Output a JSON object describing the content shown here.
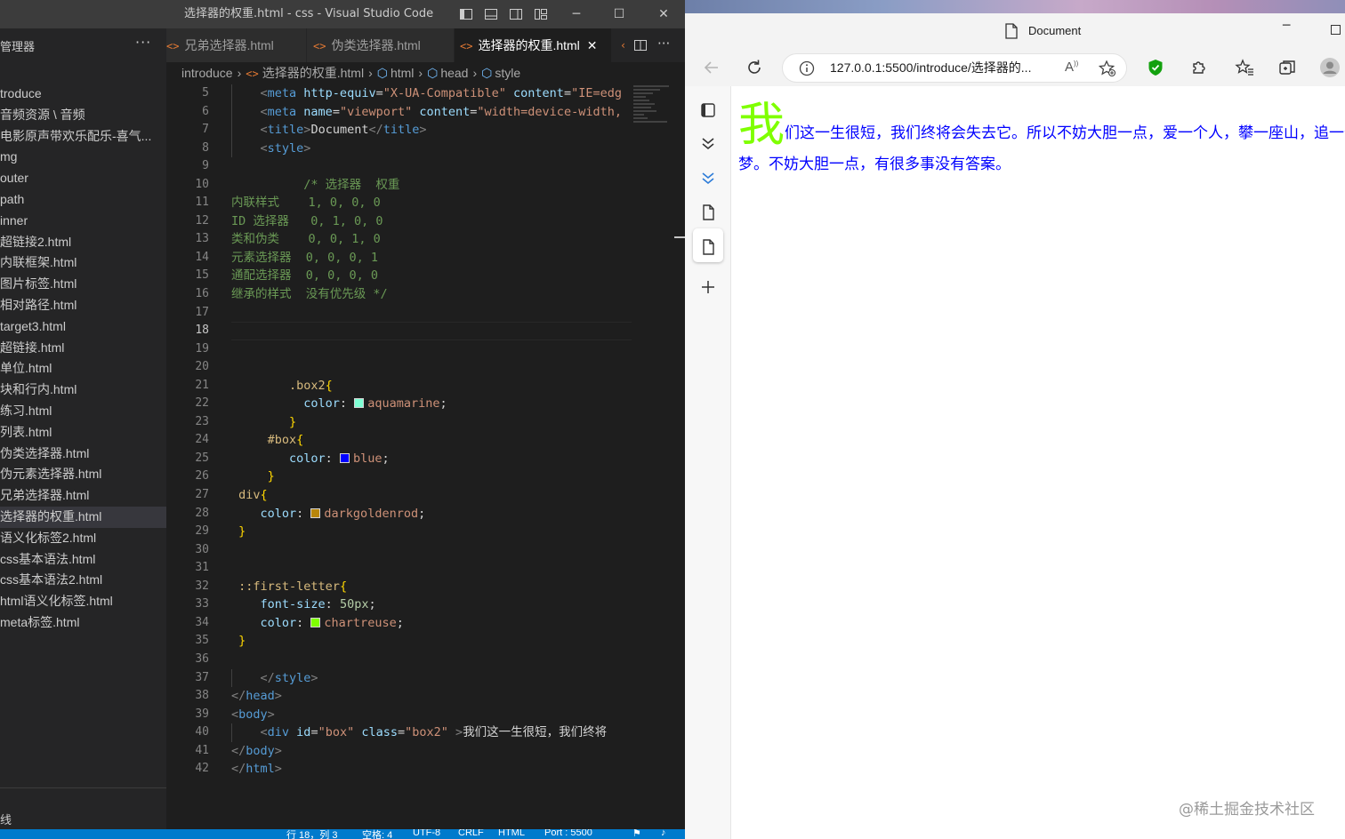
{
  "vscode": {
    "window_title": "选择器的权重.html - css - Visual Studio Code",
    "explorer": {
      "header": "管理器",
      "more": "···",
      "items": [
        {
          "label": "troduce",
          "active": false
        },
        {
          "label": "音频资源 \\ 音频",
          "active": false
        },
        {
          "label": "电影原声带欢乐配乐-喜气...",
          "active": false
        },
        {
          "label": "mg",
          "active": false
        },
        {
          "label": "outer",
          "active": false
        },
        {
          "label": "path",
          "active": false
        },
        {
          "label": "inner",
          "active": false
        },
        {
          "label": "超链接2.html",
          "active": false
        },
        {
          "label": "内联框架.html",
          "active": false
        },
        {
          "label": "图片标签.html",
          "active": false
        },
        {
          "label": "相对路径.html",
          "active": false
        },
        {
          "label": "target3.html",
          "active": false
        },
        {
          "label": "超链接.html",
          "active": false
        },
        {
          "label": "单位.html",
          "active": false
        },
        {
          "label": "块和行内.html",
          "active": false
        },
        {
          "label": "练习.html",
          "active": false
        },
        {
          "label": "列表.html",
          "active": false
        },
        {
          "label": "伪类选择器.html",
          "active": false
        },
        {
          "label": "伪元素选择器.html",
          "active": false
        },
        {
          "label": "兄弟选择器.html",
          "active": false
        },
        {
          "label": "选择器的权重.html",
          "active": true
        },
        {
          "label": "语义化标签2.html",
          "active": false
        },
        {
          "label": "css基本语法.html",
          "active": false
        },
        {
          "label": "css基本语法2.html",
          "active": false
        },
        {
          "label": "html语义化标签.html",
          "active": false
        },
        {
          "label": "meta标签.html",
          "active": false
        }
      ],
      "outline": "线"
    },
    "tabs": [
      {
        "label": "兄弟选择器.html",
        "active": false
      },
      {
        "label": "伪类选择器.html",
        "active": false
      },
      {
        "label": "选择器的权重.html",
        "active": true
      }
    ],
    "tab_icon": "<>",
    "tab_close": "✕",
    "breadcrumb": [
      "introduce",
      "选择器的权重.html",
      "html",
      "head",
      "style"
    ],
    "status": {
      "position": "行 18，列 3",
      "spaces": "空格: 4",
      "encoding": "UTF-8",
      "eol": "CRLF",
      "language": "HTML",
      "port": "Port : 5500"
    },
    "code": {
      "current_line": 18,
      "lines": [
        {
          "n": 5,
          "indent": 1,
          "tokens": [
            [
              "t-punc",
              "<"
            ],
            [
              "t-tag",
              "meta "
            ],
            [
              "t-attr",
              "http-equiv"
            ],
            [
              "t-text",
              "="
            ],
            [
              "t-str",
              "\"X-UA-Compatible\" "
            ],
            [
              "t-attr",
              "content"
            ],
            [
              "t-text",
              "="
            ],
            [
              "t-str",
              "\"IE=edg"
            ]
          ]
        },
        {
          "n": 6,
          "indent": 1,
          "tokens": [
            [
              "t-punc",
              "<"
            ],
            [
              "t-tag",
              "meta "
            ],
            [
              "t-attr",
              "name"
            ],
            [
              "t-text",
              "="
            ],
            [
              "t-str",
              "\"viewport\" "
            ],
            [
              "t-attr",
              "content"
            ],
            [
              "t-text",
              "="
            ],
            [
              "t-str",
              "\"width=device-width,"
            ]
          ]
        },
        {
          "n": 7,
          "indent": 1,
          "tokens": [
            [
              "t-punc",
              "<"
            ],
            [
              "t-tag",
              "title"
            ],
            [
              "t-punc",
              ">"
            ],
            [
              "t-text",
              "Document"
            ],
            [
              "t-punc",
              "</"
            ],
            [
              "t-tag",
              "title"
            ],
            [
              "t-punc",
              ">"
            ]
          ]
        },
        {
          "n": 8,
          "indent": 1,
          "tokens": [
            [
              "t-punc",
              "<"
            ],
            [
              "t-tag",
              "style"
            ],
            [
              "t-punc",
              ">"
            ]
          ]
        },
        {
          "n": 9,
          "indent": 0,
          "tokens": []
        },
        {
          "n": 10,
          "indent": 0,
          "tokens": [
            [
              "t-com",
              "          /* 选择器  权重"
            ]
          ]
        },
        {
          "n": 11,
          "indent": 0,
          "tokens": [
            [
              "t-com",
              "内联样式    1, 0, 0, 0"
            ]
          ]
        },
        {
          "n": 12,
          "indent": 0,
          "tokens": [
            [
              "t-com",
              "ID 选择器   0, 1, 0, 0"
            ]
          ]
        },
        {
          "n": 13,
          "indent": 0,
          "tokens": [
            [
              "t-com",
              "类和伪类    0, 0, 1, 0"
            ]
          ]
        },
        {
          "n": 14,
          "indent": 0,
          "tokens": [
            [
              "t-com",
              "元素选择器  0, 0, 0, 1"
            ]
          ]
        },
        {
          "n": 15,
          "indent": 0,
          "tokens": [
            [
              "t-com",
              "通配选择器  0, 0, 0, 0"
            ]
          ]
        },
        {
          "n": 16,
          "indent": 0,
          "tokens": [
            [
              "t-com",
              "继承的样式  没有优先级 */"
            ]
          ]
        },
        {
          "n": 17,
          "indent": 0,
          "tokens": []
        },
        {
          "n": 18,
          "indent": 0,
          "tokens": []
        },
        {
          "n": 19,
          "indent": 0,
          "tokens": []
        },
        {
          "n": 20,
          "indent": 0,
          "tokens": []
        },
        {
          "n": 21,
          "indent": 0,
          "tokens": [
            [
              "t-text",
              "        "
            ],
            [
              "t-sel",
              ".box2"
            ],
            [
              "t-br",
              "{"
            ]
          ]
        },
        {
          "n": 22,
          "indent": 0,
          "tokens": [
            [
              "t-text",
              "          "
            ],
            [
              "t-prop",
              "color"
            ],
            [
              "t-text",
              ": "
            ],
            [
              "swatch",
              "#7fffd4"
            ],
            [
              "t-val",
              "aquamarine"
            ],
            [
              "t-text",
              ";"
            ]
          ]
        },
        {
          "n": 23,
          "indent": 0,
          "tokens": [
            [
              "t-text",
              "        "
            ],
            [
              "t-br",
              "}"
            ]
          ]
        },
        {
          "n": 24,
          "indent": 0,
          "tokens": [
            [
              "t-text",
              "     "
            ],
            [
              "t-sel",
              "#box"
            ],
            [
              "t-br",
              "{"
            ]
          ]
        },
        {
          "n": 25,
          "indent": 0,
          "tokens": [
            [
              "t-text",
              "        "
            ],
            [
              "t-prop",
              "color"
            ],
            [
              "t-text",
              ": "
            ],
            [
              "swatch",
              "#0000ff"
            ],
            [
              "t-val",
              "blue"
            ],
            [
              "t-text",
              ";"
            ]
          ]
        },
        {
          "n": 26,
          "indent": 0,
          "tokens": [
            [
              "t-text",
              "     "
            ],
            [
              "t-br",
              "}"
            ]
          ]
        },
        {
          "n": 27,
          "indent": 0,
          "tokens": [
            [
              "t-text",
              " "
            ],
            [
              "t-sel",
              "div"
            ],
            [
              "t-br",
              "{"
            ]
          ]
        },
        {
          "n": 28,
          "indent": 0,
          "tokens": [
            [
              "t-text",
              "    "
            ],
            [
              "t-prop",
              "color"
            ],
            [
              "t-text",
              ": "
            ],
            [
              "swatch",
              "#b8860b"
            ],
            [
              "t-val",
              "darkgoldenrod"
            ],
            [
              "t-text",
              ";"
            ]
          ]
        },
        {
          "n": 29,
          "indent": 0,
          "tokens": [
            [
              "t-text",
              " "
            ],
            [
              "t-br",
              "}"
            ]
          ]
        },
        {
          "n": 30,
          "indent": 0,
          "tokens": []
        },
        {
          "n": 31,
          "indent": 0,
          "tokens": []
        },
        {
          "n": 32,
          "indent": 0,
          "tokens": [
            [
              "t-text",
              " "
            ],
            [
              "t-sel",
              "::first-letter"
            ],
            [
              "t-br",
              "{"
            ]
          ]
        },
        {
          "n": 33,
          "indent": 0,
          "tokens": [
            [
              "t-text",
              "    "
            ],
            [
              "t-prop",
              "font-size"
            ],
            [
              "t-text",
              ": "
            ],
            [
              "t-num",
              "50px"
            ],
            [
              "t-text",
              ";"
            ]
          ]
        },
        {
          "n": 34,
          "indent": 0,
          "tokens": [
            [
              "t-text",
              "    "
            ],
            [
              "t-prop",
              "color"
            ],
            [
              "t-text",
              ": "
            ],
            [
              "swatch",
              "#7fff00"
            ],
            [
              "t-val",
              "chartreuse"
            ],
            [
              "t-text",
              ";"
            ]
          ]
        },
        {
          "n": 35,
          "indent": 0,
          "tokens": [
            [
              "t-text",
              " "
            ],
            [
              "t-br",
              "}"
            ]
          ]
        },
        {
          "n": 36,
          "indent": 0,
          "tokens": []
        },
        {
          "n": 37,
          "indent": 1,
          "tokens": [
            [
              "t-punc",
              "</"
            ],
            [
              "t-tag",
              "style"
            ],
            [
              "t-punc",
              ">"
            ]
          ]
        },
        {
          "n": 38,
          "indent": 0,
          "tokens": [
            [
              "t-punc",
              "</"
            ],
            [
              "t-tag",
              "head"
            ],
            [
              "t-punc",
              ">"
            ]
          ]
        },
        {
          "n": 39,
          "indent": 0,
          "tokens": [
            [
              "t-punc",
              "<"
            ],
            [
              "t-tag",
              "body"
            ],
            [
              "t-punc",
              ">"
            ]
          ]
        },
        {
          "n": 40,
          "indent": 1,
          "tokens": [
            [
              "t-punc",
              "<"
            ],
            [
              "t-tag",
              "div "
            ],
            [
              "t-attr",
              "id"
            ],
            [
              "t-text",
              "="
            ],
            [
              "t-str",
              "\"box\" "
            ],
            [
              "t-attr",
              "class"
            ],
            [
              "t-text",
              "="
            ],
            [
              "t-str",
              "\"box2\" "
            ],
            [
              "t-punc",
              ">"
            ],
            [
              "t-text",
              "我们这一生很短，我们终将"
            ]
          ]
        },
        {
          "n": 41,
          "indent": 0,
          "tokens": [
            [
              "t-punc",
              "</"
            ],
            [
              "t-tag",
              "body"
            ],
            [
              "t-punc",
              ">"
            ]
          ]
        },
        {
          "n": 42,
          "indent": 0,
          "tokens": [
            [
              "t-punc",
              "</"
            ],
            [
              "t-tag",
              "html"
            ],
            [
              "t-punc",
              ">"
            ]
          ]
        }
      ]
    }
  },
  "browser": {
    "tab_title": "Document",
    "url": "127.0.0.1:5500/introduce/选择器的...",
    "page": {
      "first_letter": "我",
      "rest_text": "们这一生很短，我们终将会失去它。所以不妨大胆一点，爱一个人，攀一座山，追一个梦。不妨大胆一点，有很多事没有答案。",
      "text_color": "#0000ff",
      "first_letter_color": "#7fff00"
    },
    "watermark": "@稀土掘金技术社区"
  },
  "colors": {
    "vscode_bg": "#1e1e1e",
    "statusbar": "#007acc",
    "shield_green": "#13a10e",
    "accent_blue": "#0078d4"
  }
}
